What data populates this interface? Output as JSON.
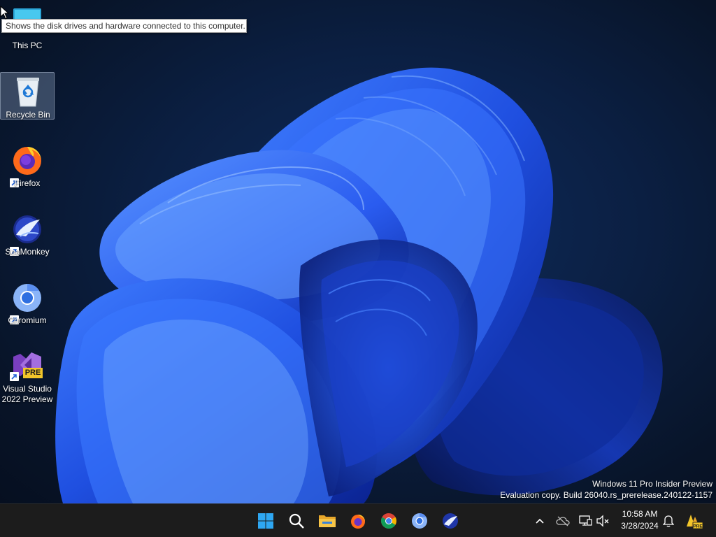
{
  "tooltip": {
    "text": "Shows the disk drives and hardware connected to this computer."
  },
  "desktop_icons": [
    {
      "label": "This PC",
      "icon": "this-pc-icon"
    },
    {
      "label": "Recycle Bin",
      "icon": "recycle-bin-icon"
    },
    {
      "label": "Firefox",
      "icon": "firefox-icon"
    },
    {
      "label": "SeaMonkey",
      "icon": "seamonkey-icon"
    },
    {
      "label": "Chromium",
      "icon": "chromium-icon"
    },
    {
      "label_line1": "Visual Studio",
      "label_line2": "2022 Preview",
      "icon": "visual-studio-preview-icon",
      "badge": "PRE"
    }
  ],
  "watermark": {
    "line1": "Windows 11 Pro Insider Preview",
    "line2": "Evaluation copy. Build 26040.rs_prerelease.240122-1157"
  },
  "taskbar": {
    "pinned": [
      "start-icon",
      "search-icon",
      "file-explorer-icon",
      "firefox-icon",
      "chrome-icon",
      "chromium-icon",
      "seamonkey-icon"
    ],
    "tray": [
      "chevron-up-icon",
      "onedrive-offline-icon",
      "network-icon",
      "volume-muted-icon",
      "notification-bell-icon",
      "dev-home-preview-icon"
    ],
    "clock": {
      "time": "10:58 AM",
      "date": "3/28/2024"
    }
  },
  "colors": {
    "accent": "#1f5bff",
    "taskbar": "#1c1c1c",
    "wallpaper_dark": "#0a1930"
  }
}
